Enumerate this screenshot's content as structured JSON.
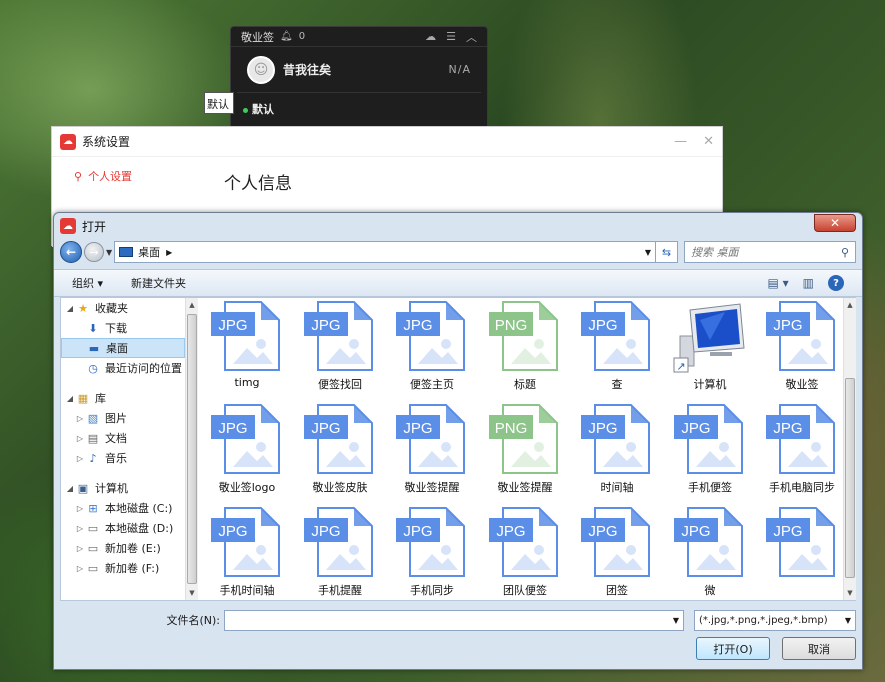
{
  "note_widget": {
    "title": "敬业签",
    "bell_count": "0",
    "user_name": "昔我往矣",
    "status": "N/A",
    "category": "默认"
  },
  "fragment_text": "默认",
  "settings": {
    "title": "系统设置",
    "sidebar": [
      {
        "label": "个人设置",
        "icon": "user-icon"
      }
    ],
    "heading": "个人信息"
  },
  "dialog": {
    "title": "打开",
    "address": "桌面",
    "search_placeholder": "搜索 桌面",
    "toolbar": {
      "organize": "组织 ▾",
      "new_folder": "新建文件夹"
    },
    "nav": [
      {
        "label": "收藏夹",
        "icon": "star-icon",
        "level": 0,
        "expander": "◢"
      },
      {
        "label": "下载",
        "icon": "download-folder-icon",
        "level": 1
      },
      {
        "label": "桌面",
        "icon": "desktop-icon",
        "level": 1,
        "selected": true
      },
      {
        "label": "最近访问的位置",
        "icon": "recent-icon",
        "level": 1
      },
      {
        "label": "库",
        "icon": "library-icon",
        "level": 0,
        "expander": "◢",
        "gap": true
      },
      {
        "label": "图片",
        "icon": "pictures-icon",
        "level": 1,
        "expander": "▷"
      },
      {
        "label": "文档",
        "icon": "documents-icon",
        "level": 1,
        "expander": "▷"
      },
      {
        "label": "音乐",
        "icon": "music-icon",
        "level": 1,
        "expander": "▷"
      },
      {
        "label": "计算机",
        "icon": "computer-icon",
        "level": 0,
        "expander": "◢",
        "gap": true
      },
      {
        "label": "本地磁盘 (C:)",
        "icon": "system-drive-icon",
        "level": 1,
        "expander": "▷"
      },
      {
        "label": "本地磁盘 (D:)",
        "icon": "drive-icon",
        "level": 1,
        "expander": "▷"
      },
      {
        "label": "新加卷 (E:)",
        "icon": "drive-icon",
        "level": 1,
        "expander": "▷"
      },
      {
        "label": "新加卷 (F:)",
        "icon": "drive-icon",
        "level": 1,
        "expander": "▷"
      }
    ],
    "files": [
      {
        "name": "timg",
        "type": "JPG"
      },
      {
        "name": "便签找回",
        "type": "JPG"
      },
      {
        "name": "便签主页",
        "type": "JPG"
      },
      {
        "name": "标题",
        "type": "PNG"
      },
      {
        "name": "查",
        "type": "JPG"
      },
      {
        "name": "计算机",
        "type": "computer"
      },
      {
        "name": "敬业签",
        "type": "JPG"
      },
      {
        "name": "敬业签logo",
        "type": "JPG"
      },
      {
        "name": "敬业签皮肤",
        "type": "JPG"
      },
      {
        "name": "敬业签提醒",
        "type": "JPG"
      },
      {
        "name": "敬业签提醒",
        "type": "PNG"
      },
      {
        "name": "时间轴",
        "type": "JPG"
      },
      {
        "name": "手机便签",
        "type": "JPG"
      },
      {
        "name": "手机电脑同步",
        "type": "JPG"
      },
      {
        "name": "手机时间轴",
        "type": "JPG"
      },
      {
        "name": "手机提醒",
        "type": "JPG"
      },
      {
        "name": "手机同步",
        "type": "JPG"
      },
      {
        "name": "团队便签",
        "type": "JPG"
      },
      {
        "name": "团签",
        "type": "JPG"
      },
      {
        "name": "微",
        "type": "JPG"
      },
      {
        "name": "",
        "type": "JPG"
      }
    ],
    "filename_label": "文件名(N):",
    "filename_value": "",
    "filetype": "(*.jpg,*.png,*.jpeg,*.bmp)",
    "open_button": "打开(O)",
    "cancel_button": "取消",
    "colors": {
      "jpg": "#5b8ee6",
      "png": "#8cc48a",
      "accent": "#e53935"
    }
  }
}
